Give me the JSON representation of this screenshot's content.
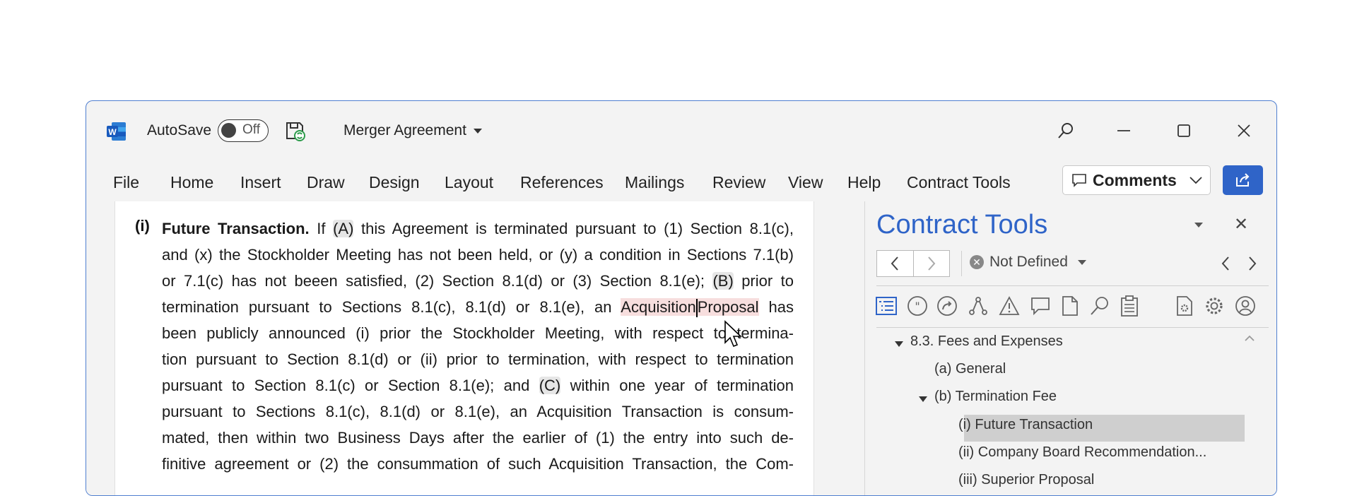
{
  "titlebar": {
    "autosave_label": "AutoSave",
    "toggle_state": "Off",
    "doc_title": "Merger Agreement"
  },
  "ribbon": {
    "tabs": [
      "File",
      "Home",
      "Insert",
      "Draw",
      "Design",
      "Layout",
      "References",
      "Mailings",
      "Review",
      "View",
      "Help",
      "Contract Tools"
    ],
    "comments_label": "Comments"
  },
  "document": {
    "para_number": "(i)",
    "lines": [
      [
        "Future Transaction.",
        " If ",
        "(A)",
        " this Agreement is terminated pursuant to (1) Section 8.1(c),"
      ],
      [
        "and (x) the Stockholder Meeting has not been held, or (y) a condition in Sections 7.1(b)"
      ],
      [
        "or 7.1(c) has not beeen satisfied, (2) Section 8.1(d) or (3) Section 8.1(e); ",
        "(B)",
        " prior to"
      ],
      [
        "termination pursuant to Sections 8.1(c), 8.1(d) or 8.1(e), an ",
        "Acquisition",
        "Proposal",
        " has"
      ],
      [
        "been publicly announced (i) prior the Stockholder Meeting, with respect to termina-"
      ],
      [
        "tion pursuant to Section 8.1(d) or (ii) prior to termination, with respect to termination"
      ],
      [
        "pursuant to Section 8.1(c) or Section 8.1(e); and ",
        "(C)",
        " within one year of termination"
      ],
      [
        "pursuant to Sections 8.1(c), 8.1(d) or 8.1(e), an Acquisition Transaction is consum-"
      ],
      [
        "mated, then within two Business Days after the earlier of (1) the entry into such de-"
      ],
      [
        "finitive agreement or (2) the consummation of such Acquisition Transaction, the Com-"
      ]
    ]
  },
  "pane": {
    "title": "Contract Tools",
    "status": "Not Defined",
    "tree": [
      {
        "label": "8.3. Fees and Expenses"
      },
      {
        "label": "(a) General"
      },
      {
        "label": "(b) Termination Fee"
      },
      {
        "label": "(i) Future Transaction"
      },
      {
        "label": "(ii) Company Board Recommendation..."
      },
      {
        "label": "(iii) Superior Proposal"
      }
    ]
  },
  "colors": {
    "accent": "#2f64c8",
    "highlight": "#f7dede",
    "selection": "#cfcfcf"
  }
}
